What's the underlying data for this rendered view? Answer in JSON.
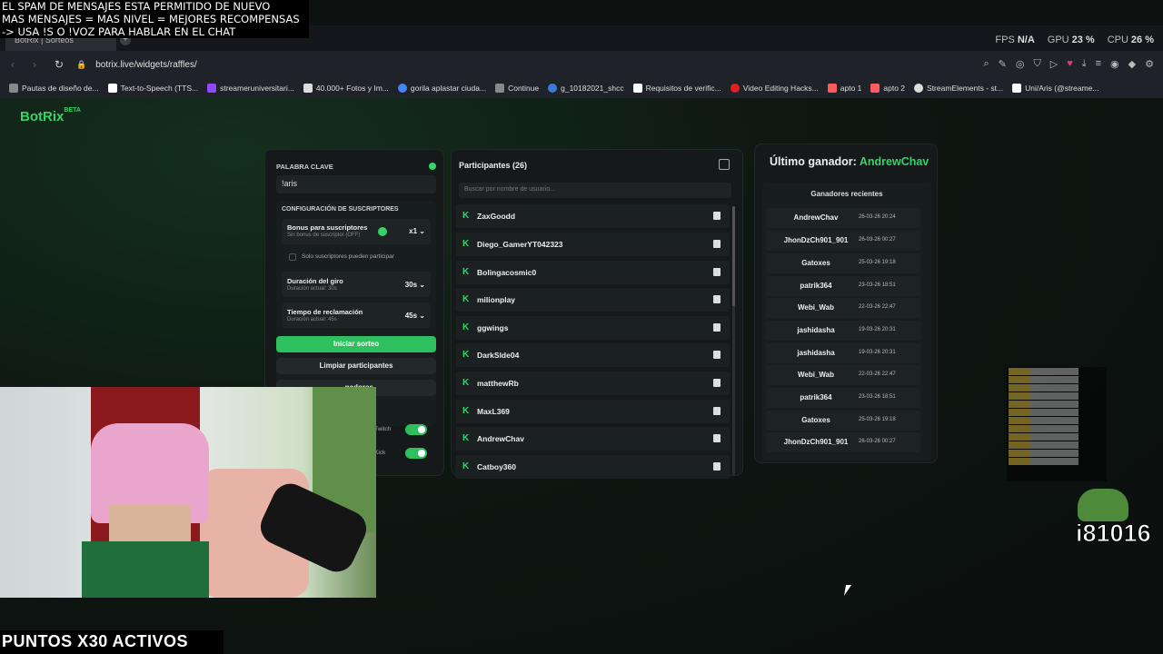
{
  "overlay": {
    "lines": [
      "EL SPAM DE MENSAJES ESTA PERMITIDO DE NUEVO",
      "MAS MENSAJES = MAS NIVEL = MEJORES RECOMPENSAS",
      "-> USA !S  O !VOZ PARA HABLAR EN EL CHAT"
    ],
    "bottom_banner": "PUNTOS X30 ACTIVOS",
    "badge_number": "i81016"
  },
  "perf": {
    "fps_label": "FPS",
    "fps_value": "N/A",
    "gpu_label": "GPU",
    "gpu_value": "23 %",
    "cpu_label": "CPU",
    "cpu_value": "26 %"
  },
  "browser": {
    "tab_title": "BotRix | Sorteos",
    "url": "botrix.live/widgets/raffles/",
    "bookmarks": [
      "Pautas de diseño de...",
      "Text-to-Speech (TTS...",
      "streameruniversitari...",
      "40.000+ Fotos y Im...",
      "gorila aplastar ciuda...",
      "Continue",
      "g_10182021_shcc",
      "Requisitos de verific...",
      "Video Editing Hacks...",
      "apto 1",
      "apto 2",
      "StreamElements - st...",
      "Uni/Aris (@streame..."
    ]
  },
  "app": {
    "logo": "BotRix",
    "logo_badge": "BETA",
    "keyword_label": "PALABRA CLAVE",
    "keyword_value": "!aris",
    "sub_config_label": "CONFIGURACIÓN DE SUSCRIPTORES",
    "sub_bonus_title": "Bonus para suscriptores",
    "sub_bonus_sub": "Sin bonus de suscriptor (OFF)",
    "sub_bonus_value": "x1",
    "subs_only_label": "Solo suscriptores pueden participar",
    "spin_title": "Duración del giro",
    "spin_sub": "Duración actual: 30s",
    "spin_value": "30s",
    "claim_title": "Tiempo de reclamación",
    "claim_sub": "Duración actual: 45s",
    "claim_value": "45s",
    "start_button": "Iniciar sorteo",
    "clear_button": "Limpiar participantes",
    "third_button": "...nadores",
    "toggle_twitch": "Twitch",
    "toggle_kick": "Kick"
  },
  "participants": {
    "header": "Participantes (26)",
    "search_placeholder": "Buscar por nombre de usuario...",
    "items": [
      "ZaxGoodd",
      "Diego_GamerYT042323",
      "Bolingacosmic0",
      "milionplay",
      "ggwings",
      "DarkSlde04",
      "matthewRb",
      "MaxL369",
      "AndrewChav",
      "Catboy360"
    ]
  },
  "winners": {
    "title_prefix": "Último ganador:",
    "last_winner": "AndrewChav",
    "recent_header": "Ganadores recientes",
    "items": [
      {
        "name": "AndrewChav",
        "date": "26-03-26 20:24"
      },
      {
        "name": "JhonDzCh901_901",
        "date": "26-03-26 00:27"
      },
      {
        "name": "Gatoxes",
        "date": "25-03-26 19:18"
      },
      {
        "name": "patrik364",
        "date": "23-03-26 18:51"
      },
      {
        "name": "Webi_Wab",
        "date": "22-03-26 22:47"
      },
      {
        "name": "jashidasha",
        "date": "19-03-26 20:31"
      },
      {
        "name": "jashidasha",
        "date": "19-03-26 20:31"
      },
      {
        "name": "Webi_Wab",
        "date": "22-03-26 22:47"
      },
      {
        "name": "patrik364",
        "date": "23-03-26 18:51"
      },
      {
        "name": "Gatoxes",
        "date": "25-03-26 19:18"
      },
      {
        "name": "JhonDzCh901_901",
        "date": "26-03-26 00:27"
      }
    ]
  },
  "colors": {
    "accent": "#35d36a",
    "button_green": "#2ec05e",
    "panel": "#15191a"
  }
}
